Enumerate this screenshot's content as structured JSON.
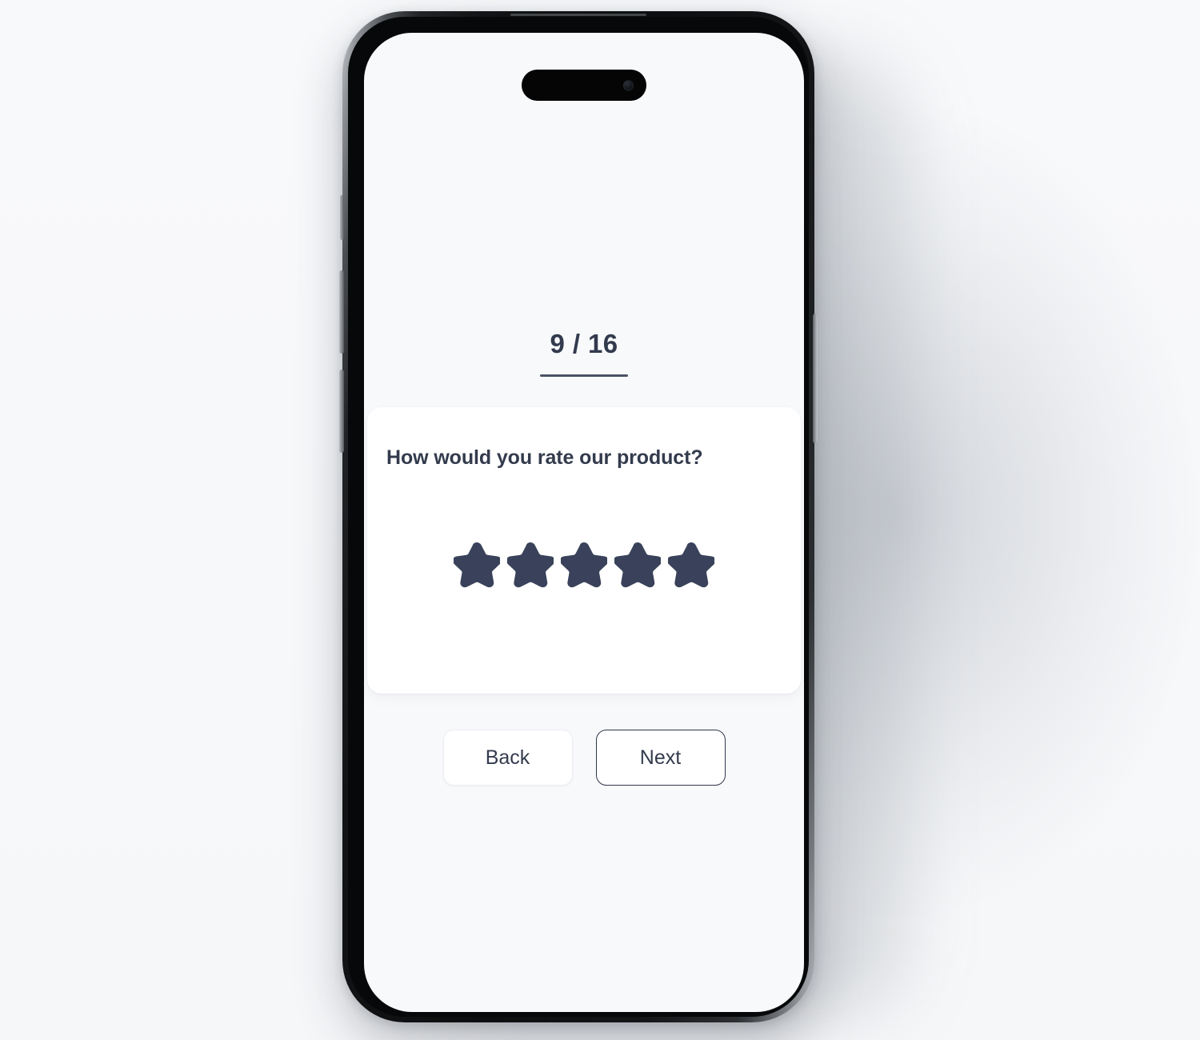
{
  "page": {
    "background_color": "#f7f8fa"
  },
  "device": {
    "name": "smartphone-mockup",
    "frame_color": "#0d0e0f",
    "screen_background": "#f8f9fb",
    "notch": "dynamic-island",
    "side_buttons": [
      "action-button",
      "volume-up-button",
      "volume-down-button",
      "power-button"
    ]
  },
  "app": {
    "progress": {
      "label": "9 / 16",
      "current": 9,
      "total": 16,
      "underline_color": "#4a5264"
    },
    "card": {
      "question": "How would you rate our product?",
      "background_color": "#ffffff",
      "rating": {
        "icon": "star-icon",
        "count": 5,
        "selected": 5,
        "color": "#39425a",
        "items": [
          {
            "index": 1,
            "label": "1 star",
            "filled": true
          },
          {
            "index": 2,
            "label": "2 stars",
            "filled": true
          },
          {
            "index": 3,
            "label": "3 stars",
            "filled": true
          },
          {
            "index": 4,
            "label": "4 stars",
            "filled": true
          },
          {
            "index": 5,
            "label": "5 stars",
            "filled": true
          }
        ]
      }
    },
    "navigation": {
      "back_label": "Back",
      "next_label": "Next",
      "text_color": "#333b4d",
      "next_border_color": "#30384a"
    }
  }
}
